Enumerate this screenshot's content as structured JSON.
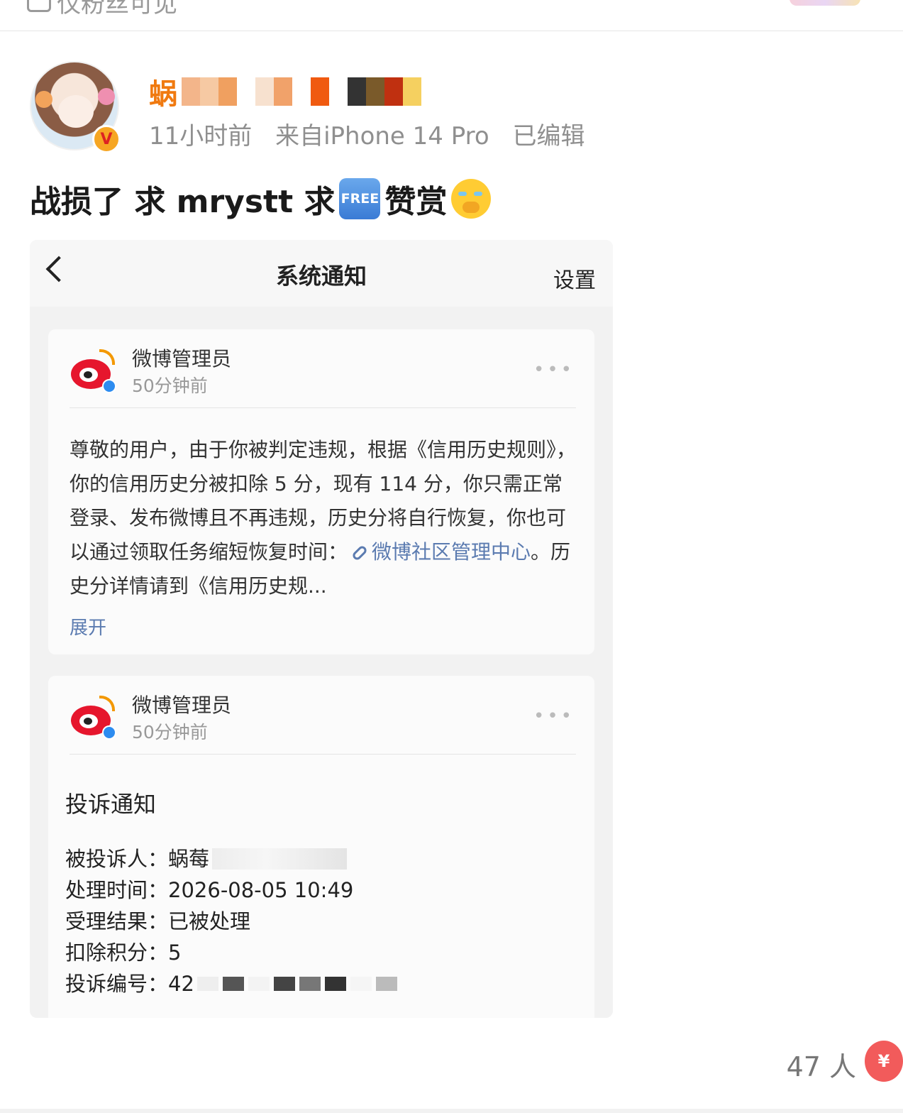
{
  "topbar": {
    "visibility": "仅粉丝可见"
  },
  "post": {
    "username_visible": "蜗",
    "time": "11小时前",
    "source": "来自iPhone 14 Pro",
    "edited": "已编辑",
    "text_part1": "战损了 求 mrystt 求",
    "free_label": "FREE",
    "text_part2": "赞赏",
    "emoji": "crying-face"
  },
  "screenshot": {
    "nav_title": "系统通知",
    "settings_label": "设置",
    "notices": [
      {
        "sender": "微博管理员",
        "time": "50分钟前",
        "body_before_link": "尊敬的用户，由于你被判定违规，根据《信用历史规则》，你的信用历史分被扣除 5 分，现有 114 分，你只需正常登录、发布微博且不再违规，历史分将自行恢复，你也可以通过领取任务缩短恢复时间：",
        "link_text": "微博社区管理中心",
        "body_after_link": "。历史分详情请到《信用历史规...",
        "expand_label": "展开"
      },
      {
        "sender": "微博管理员",
        "time": "50分钟前",
        "title": "投诉通知",
        "rows": [
          {
            "label": "被投诉人：",
            "value": "蜗莓"
          },
          {
            "label": "处理时间：",
            "value": "2026-08-05 10:49"
          },
          {
            "label": "受理结果：",
            "value": "已被处理"
          },
          {
            "label": "扣除积分：",
            "value": "5"
          },
          {
            "label": "投诉编号：",
            "value": "42"
          }
        ]
      }
    ]
  },
  "footer": {
    "reward_count": "47 人",
    "reward_symbol": "¥"
  },
  "colors": {
    "username": "#f07a10",
    "link": "#5b7bb0",
    "weibo_red": "#e6162d"
  }
}
